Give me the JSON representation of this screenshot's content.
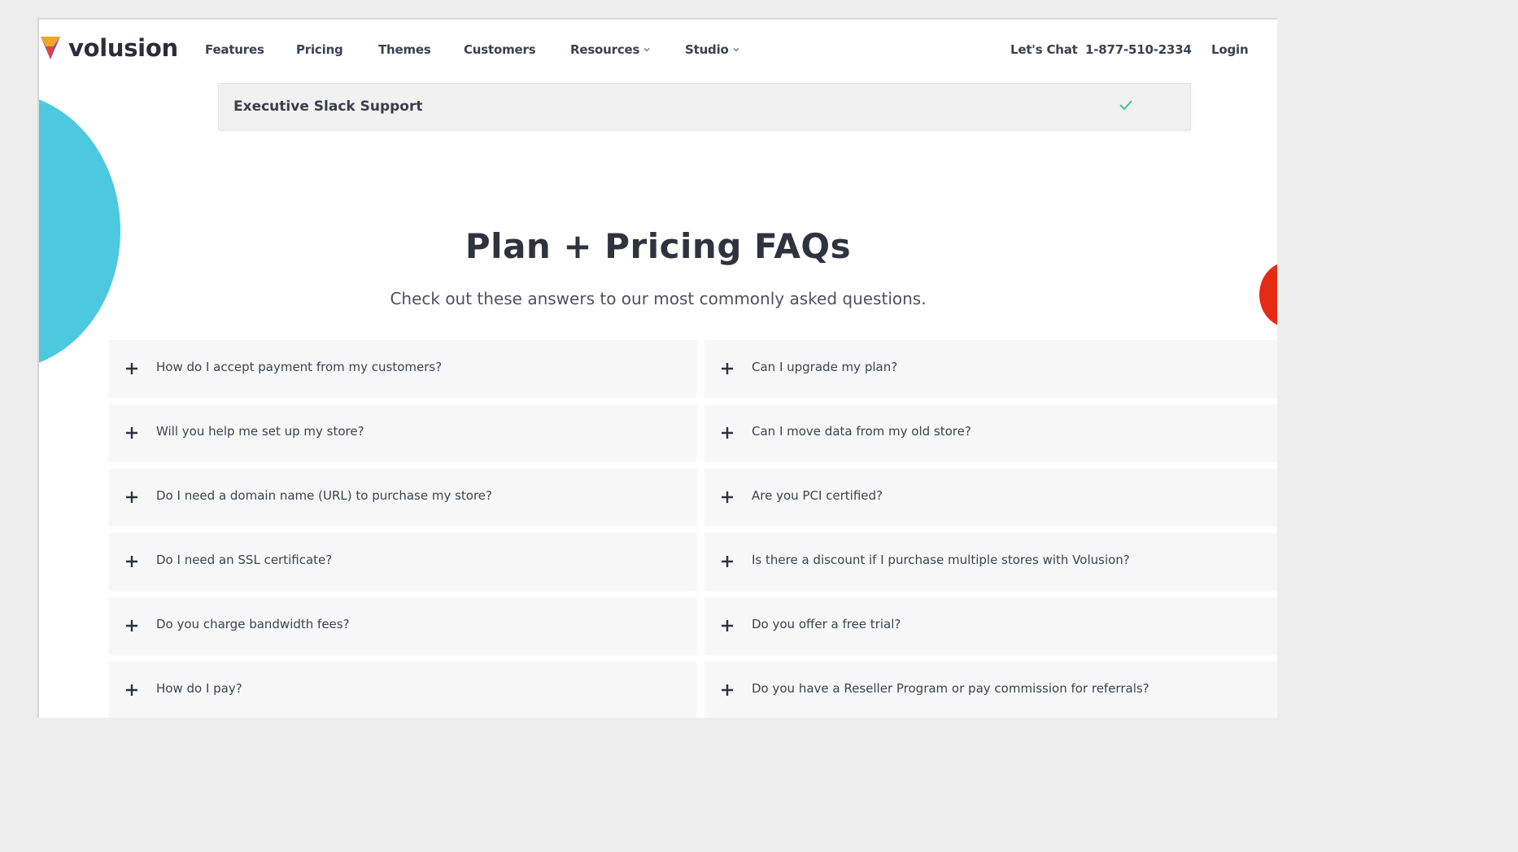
{
  "brand": {
    "name": "volusion"
  },
  "nav": {
    "links": [
      "Features",
      "Pricing",
      "Themes",
      "Customers",
      "Resources",
      "Studio"
    ],
    "chat": "Let's Chat",
    "phone": "1-877-510-2334",
    "login": "Login"
  },
  "plan_row": {
    "label": "Executive Slack Support",
    "included": true
  },
  "faq_section": {
    "title": "Plan + Pricing FAQs",
    "subtitle": "Check out these answers to our most commonly asked questions.",
    "left": [
      "How do I accept payment from my customers?",
      "Will you help me set up my store?",
      "Do I need a domain name (URL) to purchase my store?",
      "Do I need an SSL certificate?",
      "Do you charge bandwidth fees?",
      "How do I pay?"
    ],
    "right": [
      "Can I upgrade my plan?",
      "Can I move data from my old store?",
      "Are you PCI certified?",
      "Is there a discount if I purchase multiple stores with Volusion?",
      "Do you offer a free trial?",
      "Do you have a Reseller Program or pay commission for referrals?"
    ]
  },
  "colors": {
    "accent_cyan": "#4cc8df",
    "accent_red": "#e52b14",
    "check_green": "#3fc48a"
  }
}
